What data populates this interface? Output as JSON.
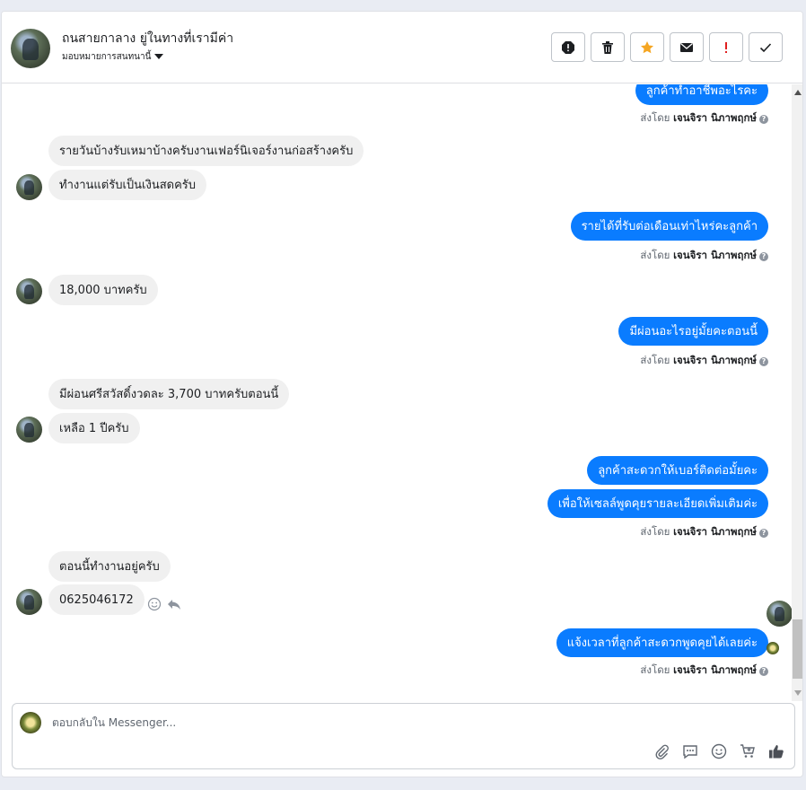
{
  "header": {
    "name": "ถนสายกาลาง ยู่ในทางที่เรามีค่า",
    "assign_label": "มอบหมายการสนทนานี้",
    "actions": [
      "spam-icon",
      "trash-icon",
      "star-icon",
      "mail-icon",
      "exclamation-icon",
      "check-icon"
    ],
    "star_color": "#f5a623",
    "exclaim_color": "#e02020"
  },
  "messages": {
    "out1": "ลูกค้าทำอาชีพอะไรคะ",
    "in1": "รายวันบ้างรับเหมาบ้างครับงานเฟอร์นิเจอร์งานก่อสร้างครับ",
    "in2": "ทำงานแต่รับเป็นเงินสดครับ",
    "out2": "รายได้ที่รับต่อเดือนเท่าไหร่คะลูกค้า",
    "in3": "18,000 บาทครับ",
    "out3": "มีผ่อนอะไรอยู่มั้ยคะตอนนี้",
    "in4": "มีผ่อนศรีสวัสดิ์งวดละ 3,700 บาทครับตอนนี้",
    "in5": "เหลือ 1 ปีครับ",
    "out4": "ลูกค้าสะดวกให้เบอร์ติดต่อมั้ยคะ",
    "out5": "เพื่อให้เซลล์พูดคุยรายละเอียดเพิ่มเติมค่ะ",
    "in6": "ตอนนี้ทำงานอยู่ครับ",
    "in7": "0625046172",
    "out6": "แจ้งเวลาที่ลูกค้าสะดวกพูดคุยได้เลยค่ะ"
  },
  "sent_by": {
    "prefix": "ส่งโดย",
    "name": "เจนจิรา นิภาพฤกษ์",
    "help": "?"
  },
  "composer": {
    "placeholder": "ตอบกลับใน Messenger...",
    "icons": [
      "attachment-icon",
      "saved-reply-icon",
      "emoji-icon",
      "cart-icon",
      "like-icon"
    ]
  },
  "colors": {
    "outgoing_bubble": "#0a7cff",
    "incoming_bubble": "#f0f0f0"
  }
}
